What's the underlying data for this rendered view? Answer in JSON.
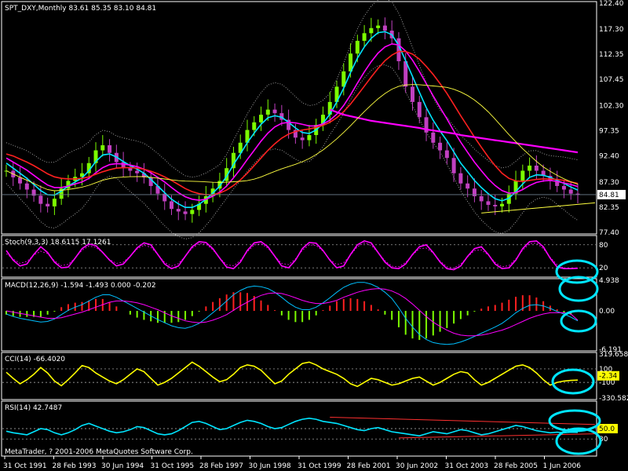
{
  "colors": {
    "background": "#000000",
    "axis": "#ffffff",
    "bull": "#7cfc00",
    "bear": "#c040c0",
    "ma_fast": "#00e5ff",
    "ma_mid": "#ff00ff",
    "ma_slow": "#ff2020",
    "ma_long": "#ffff40",
    "ma_magenta_long": "#ff00ff",
    "bands": "#c0c0c0",
    "stoch": "#ff00ff",
    "cci": "#ffff00",
    "rsi": "#00e5ff",
    "annotation": "#00e5ff",
    "trendline": "#ff3030",
    "support": "#ffff40",
    "price_badge_bg": "#ffffff",
    "price_badge_text": "#000000",
    "marker_yellow": "#ffff00"
  },
  "chart_data": [
    {
      "type": "line",
      "panel": "price",
      "title": "SPT_DXY,Monthly  83.61 85.35 83.10 84.81",
      "ylim": [
        77.4,
        122.4
      ],
      "y_ticks": [
        "122.40",
        "117.30",
        "112.35",
        "107.45",
        "102.30",
        "97.35",
        "92.40",
        "87.30",
        "82.35",
        "77.40"
      ],
      "current_price": "84.81",
      "x_labels": [
        "31 Oct 1991",
        "28 Feb 1993",
        "30 Jun 1994",
        "31 Oct 1995",
        "28 Feb 1997",
        "30 Jun 1998",
        "31 Oct 1999",
        "28 Feb 2001",
        "30 Jun 2002",
        "31 Oct 2003",
        "28 Feb 2005",
        "1 Jun 2006"
      ],
      "close": [
        89.5,
        88.2,
        87.0,
        85.8,
        84.6,
        83.0,
        82.5,
        84.0,
        86.0,
        87.5,
        88.3,
        89.0,
        91.0,
        93.5,
        94.5,
        93.0,
        91.2,
        90.0,
        89.5,
        89.0,
        88.2,
        86.5,
        85.0,
        83.5,
        82.0,
        81.5,
        81.0,
        81.8,
        83.0,
        84.5,
        86.0,
        87.5,
        90.0,
        93.0,
        95.0,
        97.5,
        99.0,
        100.5,
        101.5,
        100.8,
        99.5,
        97.5,
        96.0,
        95.5,
        96.5,
        98.5,
        100.5,
        103.0,
        106.0,
        109.0,
        112.5,
        115.0,
        116.5,
        117.5,
        118.0,
        117.0,
        115.5,
        111.0,
        106.0,
        103.0,
        100.0,
        97.0,
        95.0,
        93.5,
        92.0,
        89.0,
        87.0,
        86.0,
        84.5,
        83.5,
        82.8,
        82.5,
        83.0,
        85.0,
        87.5,
        89.5,
        90.5,
        89.5,
        88.5,
        87.5,
        86.5,
        85.8,
        85.0,
        84.81
      ],
      "series": [
        {
          "name": "",
          "values": [
            91.0,
            90.0,
            89.0,
            88.0,
            86.8,
            85.6,
            84.8,
            84.7,
            85.5,
            86.5,
            87.3,
            88.1,
            89.5,
            91.3,
            92.6,
            92.8,
            92.2,
            91.3,
            90.5,
            89.8,
            89.0,
            87.8,
            86.5,
            85.2,
            83.9,
            83.0,
            82.3,
            82.3,
            82.9,
            83.9,
            85.1,
            86.5,
            88.4,
            90.7,
            92.8,
            95.0,
            96.9,
            98.6,
            99.9,
            100.3,
            100.0,
            99.0,
            97.9,
            97.0,
            96.8,
            97.5,
            98.8,
            100.6,
            103.0,
            105.7,
            108.8,
            111.6,
            113.8,
            115.5,
            116.6,
            116.8,
            116.2,
            114.1,
            111.1,
            108.0,
            104.9,
            101.9,
            99.4,
            97.3,
            95.4,
            93.2,
            91.0,
            89.3,
            87.6,
            86.2,
            85.0,
            84.0,
            83.6,
            84.1,
            85.4,
            86.9,
            88.2,
            88.7,
            88.6,
            88.2,
            87.6,
            87.0,
            86.3,
            85.7
          ]
        },
        {
          "name": "",
          "values": [
            92.0,
            91.2,
            90.4,
            89.6,
            88.6,
            87.6,
            86.7,
            86.2,
            86.2,
            86.5,
            86.9,
            87.3,
            88.0,
            89.1,
            90.1,
            90.7,
            90.9,
            90.8,
            90.6,
            90.3,
            89.8,
            89.1,
            88.2,
            87.3,
            86.2,
            85.2,
            84.4,
            83.9,
            83.7,
            83.9,
            84.5,
            85.3,
            86.5,
            88.1,
            89.8,
            91.7,
            93.5,
            95.3,
            96.9,
            98.1,
            98.8,
            99.0,
            98.9,
            98.6,
            98.3,
            98.3,
            98.7,
            99.4,
            100.6,
            102.3,
            104.4,
            106.7,
            108.9,
            110.9,
            112.6,
            113.8,
            114.4,
            114.2,
            113.0,
            111.2,
            109.0,
            106.6,
            104.2,
            101.9,
            99.7,
            97.3,
            95.1,
            93.1,
            91.2,
            89.5,
            87.9,
            86.6,
            85.6,
            85.1,
            85.2,
            85.8,
            86.6,
            87.2,
            87.5,
            87.6,
            87.4,
            87.1,
            86.8,
            86.4
          ]
        },
        {
          "name": "",
          "values": [
            92.8,
            92.4,
            91.8,
            91.2,
            90.5,
            89.7,
            88.9,
            88.3,
            88.0,
            87.9,
            87.9,
            88.0,
            88.3,
            88.8,
            89.3,
            89.7,
            90.0,
            90.1,
            90.1,
            90.0,
            89.8,
            89.4,
            88.9,
            88.3,
            87.6,
            86.8,
            86.0,
            85.4,
            85.0,
            84.8,
            84.8,
            85.1,
            85.7,
            86.6,
            87.7,
            89.0,
            90.5,
            92.0,
            93.5,
            94.8,
            95.9,
            96.7,
            97.2,
            97.5,
            97.7,
            98.0,
            98.4,
            99.0,
            99.9,
            101.1,
            102.6,
            104.3,
            106.1,
            107.9,
            109.6,
            111.1,
            112.2,
            112.9,
            112.9,
            112.4,
            111.4,
            110.0,
            108.4,
            106.6,
            104.7,
            102.5,
            100.3,
            98.2,
            96.1,
            94.1,
            92.2,
            90.5,
            89.0,
            88.0,
            87.5,
            87.4,
            87.6,
            87.8,
            87.9,
            87.9,
            87.8,
            87.6,
            87.3,
            87.0
          ]
        },
        {
          "name": "",
          "values": [
            null,
            null,
            null,
            null,
            null,
            null,
            null,
            null,
            null,
            null,
            null,
            null,
            null,
            null,
            null,
            null,
            null,
            null,
            null,
            null,
            null,
            null,
            null,
            null,
            null,
            null,
            null,
            null,
            null,
            null,
            null,
            null,
            null,
            null,
            null,
            null,
            null,
            null,
            null,
            null,
            null,
            null,
            null,
            null,
            null,
            null,
            null,
            101.5,
            101.0,
            100.5,
            100.2,
            99.9,
            99.6,
            99.3,
            99.1,
            98.9,
            98.7,
            98.5,
            98.3,
            98.1,
            97.9,
            97.6,
            97.4,
            97.2,
            97.0,
            96.8,
            96.5,
            96.3,
            96.1,
            95.9,
            95.7,
            95.5,
            95.3,
            95.1,
            94.9,
            94.7,
            94.5,
            94.3,
            94.1,
            93.9,
            93.7,
            93.5,
            93.3,
            93.1
          ]
        }
      ]
    },
    {
      "type": "line",
      "panel": "stoch",
      "title": "Stoch(9,3,3) 18.6115 17.1261",
      "ylim": [
        0,
        100
      ],
      "y_ticks": [
        "80",
        "20"
      ],
      "values": [
        65,
        40,
        25,
        30,
        55,
        75,
        60,
        35,
        20,
        22,
        45,
        70,
        82,
        78,
        60,
        40,
        25,
        30,
        50,
        72,
        85,
        80,
        55,
        30,
        18,
        25,
        50,
        75,
        88,
        86,
        70,
        45,
        22,
        18,
        35,
        65,
        85,
        88,
        75,
        50,
        25,
        20,
        40,
        70,
        86,
        84,
        65,
        40,
        20,
        25,
        55,
        80,
        90,
        85,
        60,
        35,
        20,
        18,
        30,
        55,
        75,
        80,
        60,
        35,
        18,
        15,
        25,
        50,
        70,
        75,
        55,
        30,
        18,
        20,
        40,
        70,
        88,
        90,
        75,
        45,
        22,
        18,
        18,
        19
      ]
    },
    {
      "type": "bar",
      "panel": "macd",
      "title": "MACD(12,26,9) -1.594 -1.493 0.000 -0.202",
      "ylim": [
        -6.191,
        4.938
      ],
      "y_ticks": [
        "4.938",
        "0.00",
        "-6.191"
      ],
      "values": [
        -0.5,
        -0.9,
        -1.2,
        -1.4,
        -1.6,
        -1.8,
        -1.7,
        -1.3,
        -0.6,
        0.1,
        0.6,
        1.0,
        1.6,
        2.2,
        2.6,
        2.6,
        2.2,
        1.6,
        1.0,
        0.4,
        -0.2,
        -0.8,
        -1.4,
        -1.9,
        -2.4,
        -2.7,
        -2.8,
        -2.5,
        -2.0,
        -1.2,
        -0.3,
        0.6,
        1.6,
        2.6,
        3.3,
        3.8,
        4.0,
        3.9,
        3.6,
        3.0,
        2.2,
        1.3,
        0.6,
        0.2,
        0.2,
        0.6,
        1.3,
        2.1,
        3.0,
        3.8,
        4.3,
        4.6,
        4.6,
        4.3,
        3.8,
        3.0,
        2.0,
        0.5,
        -1.2,
        -2.6,
        -3.8,
        -4.6,
        -5.1,
        -5.3,
        -5.4,
        -5.3,
        -5.0,
        -4.6,
        -4.1,
        -3.6,
        -3.1,
        -2.6,
        -2.0,
        -1.2,
        -0.3,
        0.4,
        0.9,
        1.0,
        0.8,
        0.4,
        -0.1,
        -0.5,
        -1.0,
        -1.6
      ],
      "signal": [
        0.0,
        -0.2,
        -0.4,
        -0.6,
        -0.8,
        -1.0,
        -1.2,
        -1.2,
        -1.1,
        -0.8,
        -0.5,
        -0.2,
        0.2,
        0.6,
        1.0,
        1.4,
        1.6,
        1.6,
        1.5,
        1.3,
        1.0,
        0.6,
        0.2,
        -0.3,
        -0.8,
        -1.2,
        -1.6,
        -1.8,
        -1.9,
        -1.8,
        -1.5,
        -1.1,
        -0.6,
        0.1,
        0.8,
        1.4,
        2.0,
        2.5,
        2.8,
        2.9,
        2.8,
        2.5,
        2.1,
        1.7,
        1.4,
        1.2,
        1.2,
        1.4,
        1.7,
        2.2,
        2.6,
        3.0,
        3.3,
        3.5,
        3.6,
        3.5,
        3.2,
        2.7,
        2.0,
        1.1,
        0.1,
        -0.9,
        -1.8,
        -2.5,
        -3.1,
        -3.6,
        -3.9,
        -4.0,
        -4.0,
        -3.9,
        -3.7,
        -3.4,
        -3.1,
        -2.7,
        -2.2,
        -1.7,
        -1.2,
        -0.8,
        -0.5,
        -0.3,
        -0.3,
        -0.3,
        -0.5,
        -1.5
      ]
    },
    {
      "type": "line",
      "panel": "cci",
      "title": "CCI(14) -66.4020",
      "ylim": [
        -330.582,
        319.6587
      ],
      "y_ticks": [
        "319.6587",
        "100",
        "-100",
        "-330.582"
      ],
      "marker": "-2.34",
      "values": [
        50,
        -40,
        -120,
        -60,
        20,
        120,
        40,
        -80,
        -150,
        -60,
        40,
        150,
        120,
        40,
        -20,
        -80,
        -120,
        -60,
        20,
        100,
        60,
        -40,
        -140,
        -100,
        -40,
        40,
        120,
        200,
        140,
        60,
        -20,
        -90,
        -60,
        20,
        120,
        160,
        140,
        80,
        -20,
        -120,
        -80,
        20,
        100,
        180,
        200,
        160,
        100,
        60,
        20,
        -40,
        -120,
        -160,
        -100,
        -40,
        -60,
        -100,
        -140,
        -120,
        -80,
        -40,
        -20,
        -80,
        -140,
        -100,
        -40,
        20,
        60,
        40,
        -60,
        -140,
        -100,
        -40,
        20,
        80,
        140,
        160,
        120,
        40,
        -60,
        -140,
        -100,
        -80,
        -70,
        -66
      ]
    },
    {
      "type": "line",
      "panel": "rsi",
      "title": "RSI(14) 42.7487",
      "ylim": [
        0,
        100
      ],
      "y_ticks": [
        "50",
        "30"
      ],
      "marker": "50.0",
      "values": [
        45,
        42,
        40,
        38,
        44,
        50,
        48,
        42,
        38,
        42,
        48,
        56,
        60,
        55,
        50,
        45,
        42,
        44,
        48,
        54,
        52,
        46,
        40,
        38,
        40,
        46,
        54,
        62,
        64,
        60,
        54,
        48,
        50,
        56,
        62,
        66,
        64,
        60,
        54,
        50,
        52,
        58,
        64,
        68,
        70,
        68,
        64,
        62,
        60,
        56,
        52,
        48,
        46,
        50,
        52,
        48,
        44,
        42,
        40,
        38,
        36,
        40,
        44,
        42,
        40,
        44,
        48,
        46,
        42,
        38,
        40,
        44,
        48,
        52,
        56,
        54,
        50,
        46,
        44,
        42,
        43,
        42,
        43,
        42.7487
      ]
    }
  ],
  "watermark": "MetaTrader, ? 2001-2006 MetaQuotes Software Corp."
}
